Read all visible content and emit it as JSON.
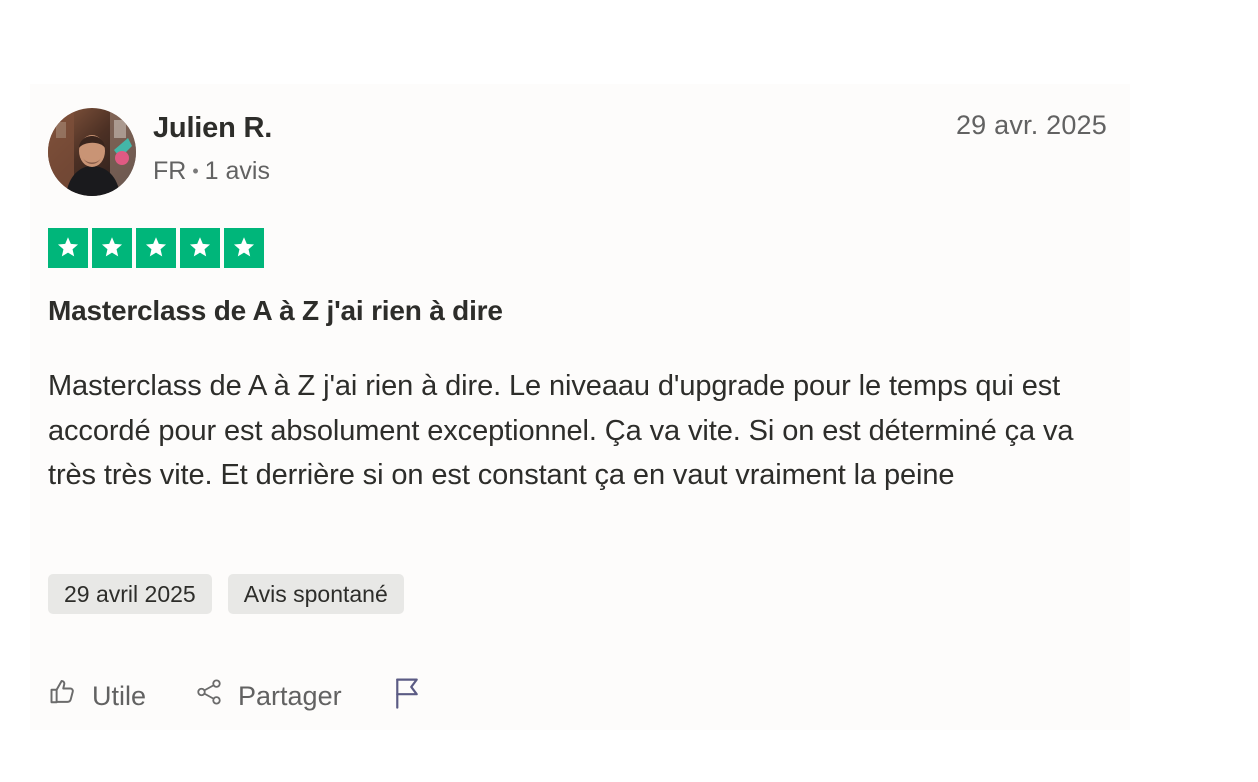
{
  "reviewer": {
    "name": "Julien R.",
    "country": "FR",
    "separator": "•",
    "review_count": "1 avis"
  },
  "review": {
    "date_short": "29 avr. 2025",
    "rating": 5,
    "rating_max": 5,
    "star_color": "#00b67a",
    "title": "Masterclass de A à Z j'ai rien à dire",
    "body": "Masterclass de A à Z j'ai rien à dire. Le niveaau d'upgrade pour le temps qui est accordé pour est absolument exceptionnel. Ça va vite. Si on est déterminé ça va très très vite. Et derrière si on est constant ça en vaut vraiment la peine",
    "tags": [
      "29 avril 2025",
      "Avis spontané"
    ]
  },
  "actions": {
    "useful_label": "Utile",
    "share_label": "Partager"
  },
  "icons": {
    "useful": "thumbs-up-icon",
    "share": "share-icon",
    "report": "flag-icon",
    "star": "star-icon"
  }
}
